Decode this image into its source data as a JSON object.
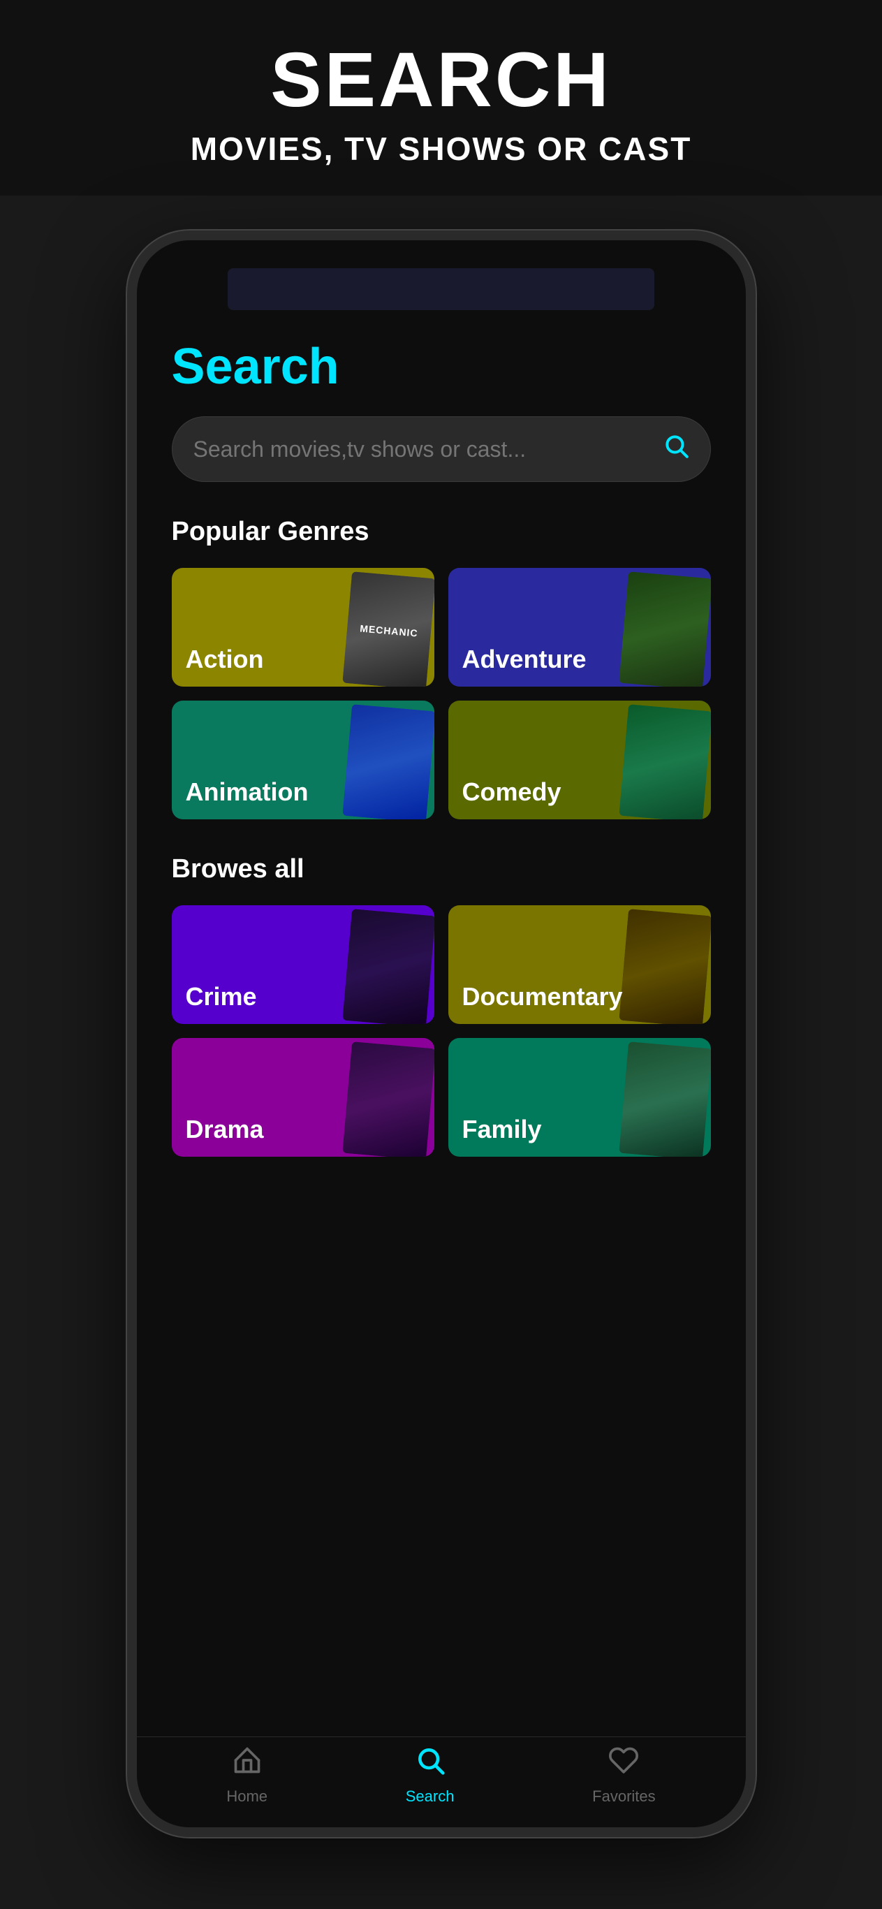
{
  "banner": {
    "title": "SEARCH",
    "subtitle": "MOVIES, TV SHOWS OR CAST"
  },
  "screen": {
    "heading": "Search",
    "search_placeholder": "Search movies,tv shows or cast...",
    "popular_genres_label": "Popular Genres",
    "browse_all_label": "Browes all",
    "genres_popular": [
      {
        "id": "action",
        "label": "Action",
        "color_class": "genre-action",
        "poster_class": "mechanic-poster"
      },
      {
        "id": "adventure",
        "label": "Adventure",
        "color_class": "genre-adventure",
        "poster_class": "jungle-poster"
      },
      {
        "id": "animation",
        "label": "Animation",
        "color_class": "genre-animation",
        "poster_class": "cinderella-poster"
      },
      {
        "id": "comedy",
        "label": "Comedy",
        "color_class": "genre-comedy",
        "poster_class": "rick-poster"
      }
    ],
    "genres_all": [
      {
        "id": "crime",
        "label": "Crime",
        "color_class": "genre-crime",
        "poster_class": "peaky-poster"
      },
      {
        "id": "documentary",
        "label": "Documentary",
        "color_class": "genre-documentary",
        "poster_class": "social-poster"
      },
      {
        "id": "drama",
        "label": "Drama",
        "color_class": "genre-drama",
        "poster_class": "drama-poster"
      },
      {
        "id": "family",
        "label": "Family",
        "color_class": "genre-family",
        "poster_class": "family-poster"
      }
    ]
  },
  "nav": {
    "items": [
      {
        "id": "home",
        "label": "Home",
        "icon": "⌂",
        "active": false
      },
      {
        "id": "search",
        "label": "Search",
        "icon": "⊙",
        "active": true
      },
      {
        "id": "favorites",
        "label": "Favorites",
        "icon": "♡",
        "active": false
      }
    ]
  },
  "colors": {
    "accent": "#00e5ff",
    "bg": "#0d0d0d",
    "card_bg": "#2a2a2a"
  }
}
